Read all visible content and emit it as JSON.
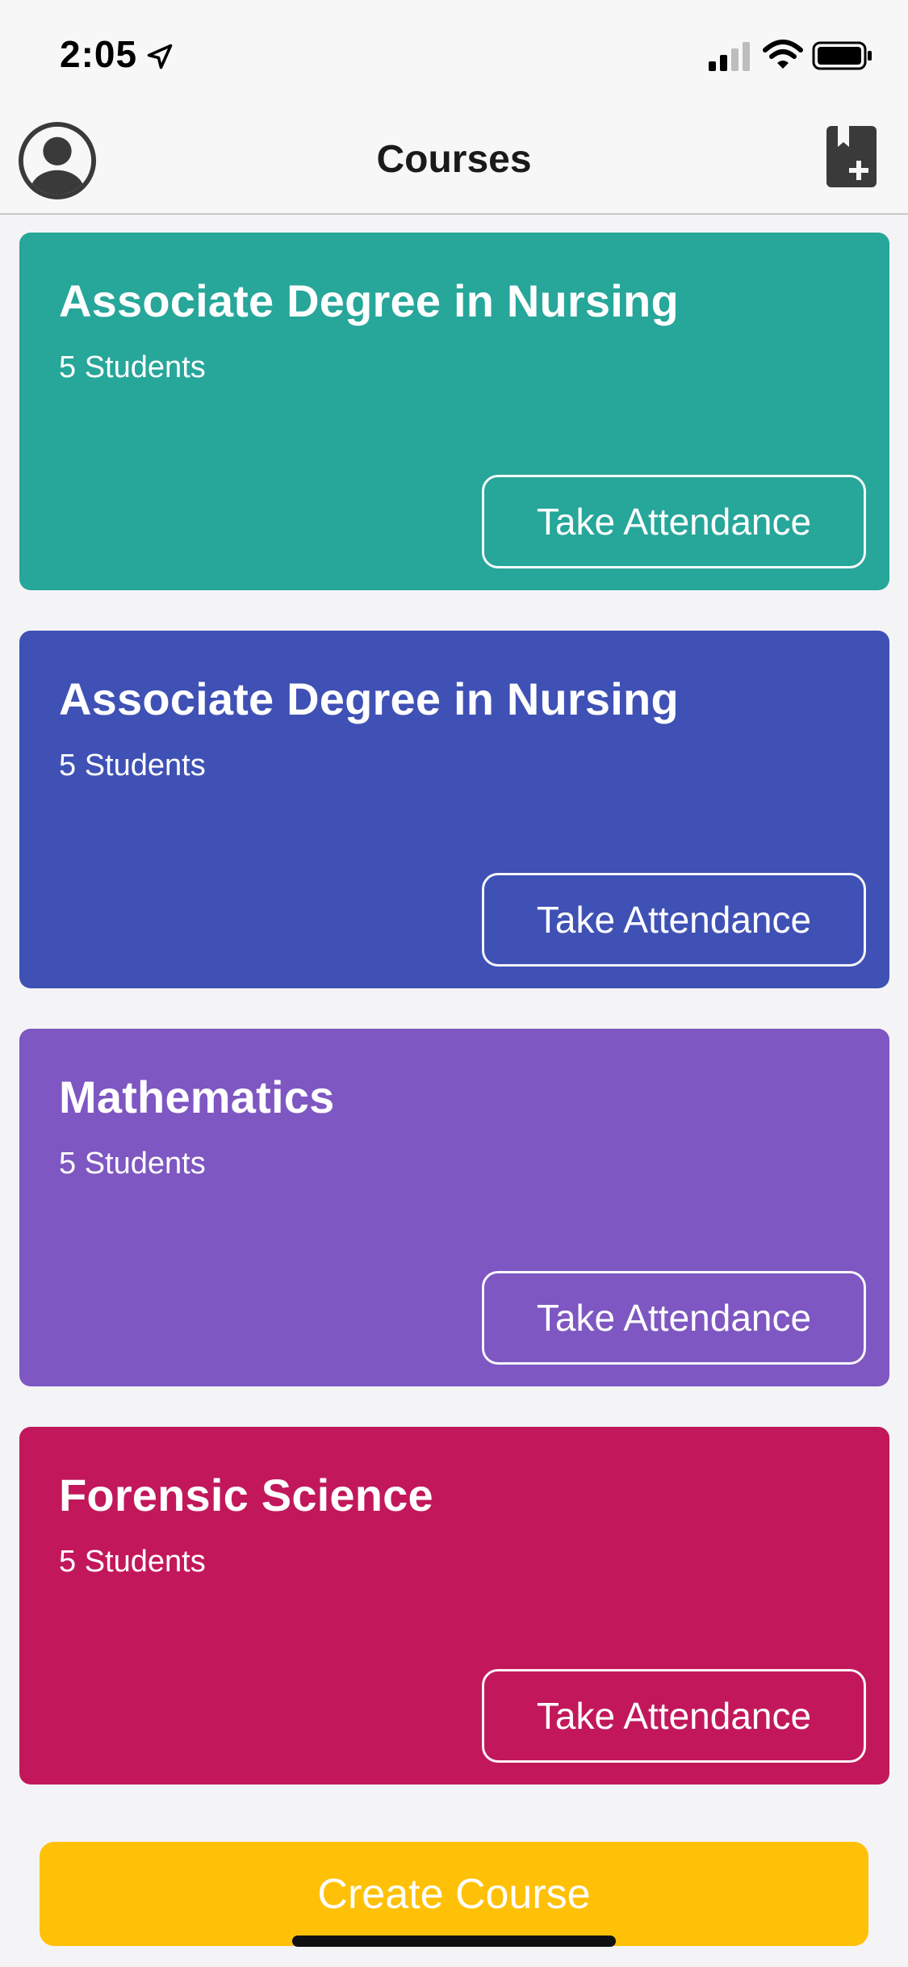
{
  "status_bar": {
    "time": "2:05"
  },
  "nav": {
    "title": "Courses"
  },
  "courses": [
    {
      "name": "Associate Degree in Nursing",
      "count": "5 Students",
      "action": "Take Attendance",
      "color": "#27A69A"
    },
    {
      "name": "Associate Degree in Nursing",
      "count": "5 Students",
      "action": "Take Attendance",
      "color": "#3F51B5"
    },
    {
      "name": "Mathematics",
      "count": "5 Students",
      "action": "Take Attendance",
      "color": "#7E57C2"
    },
    {
      "name": "Forensic Science",
      "count": "5 Students",
      "action": "Take Attendance",
      "color": "#C2185B"
    }
  ],
  "footer": {
    "create_label": "Create Course",
    "create_color": "#FFC107"
  }
}
